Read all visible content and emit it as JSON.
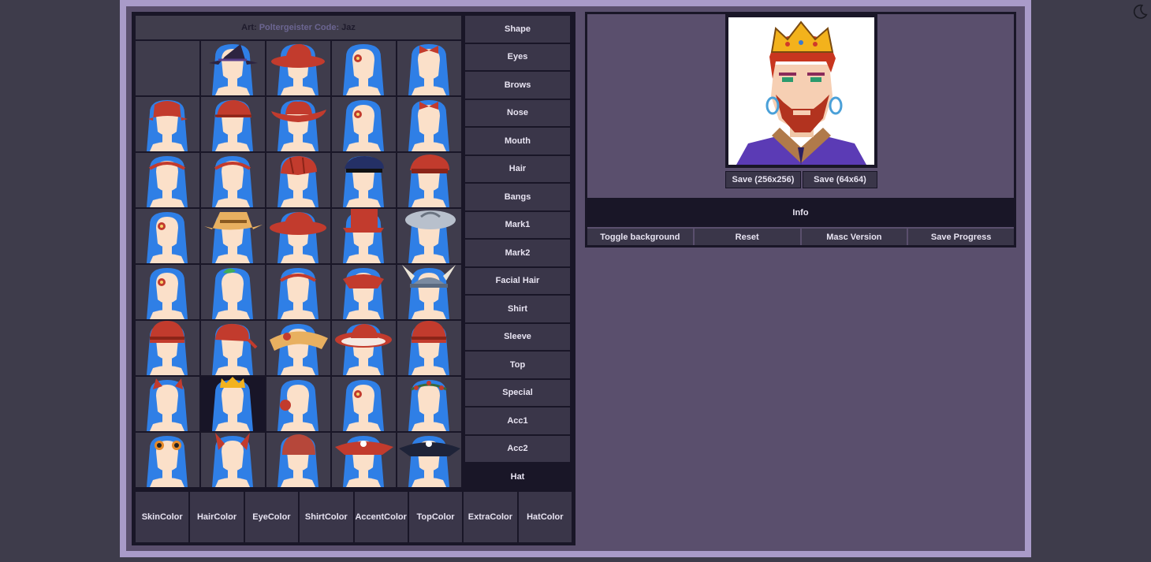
{
  "credit": {
    "art_label": "Art:",
    "art_name": "Poltergeister",
    "code_label": "Code:",
    "code_name": "Jaz"
  },
  "categories": [
    "Shape",
    "Eyes",
    "Brows",
    "Nose",
    "Mouth",
    "Hair",
    "Bangs",
    "Mark1",
    "Mark2",
    "Facial Hair",
    "Shirt",
    "Sleeve",
    "Top",
    "Special",
    "Acc1",
    "Acc2",
    "Hat"
  ],
  "active_category": "Hat",
  "colors": [
    {
      "line1": "Skin",
      "line2": "Color"
    },
    {
      "line1": "Hair",
      "line2": "Color"
    },
    {
      "line1": "Eye",
      "line2": "Color"
    },
    {
      "line1": "Shirt",
      "line2": "Color"
    },
    {
      "line1": "Accent",
      "line2": "Color"
    },
    {
      "line1": "Top",
      "line2": "Color"
    },
    {
      "line1": "Extra",
      "line2": "Color"
    },
    {
      "line1": "Hat",
      "line2": "Color"
    }
  ],
  "save": {
    "large": "Save (256x256)",
    "small": "Save (64x64)"
  },
  "info_label": "Info",
  "actions": [
    "Toggle background",
    "Reset",
    "Masc Version",
    "Save Progress"
  ],
  "hat_options": [
    "none",
    "witch-hat",
    "wide-red-hat",
    "flower-clip",
    "bow",
    "bucket-hat",
    "cap",
    "cowboy-hat",
    "flower-clip",
    "bow",
    "headband",
    "headband",
    "newsboy-cap",
    "navy-cap",
    "red-cap",
    "flower-clip",
    "straw-hat",
    "red-brim-hat",
    "top-hat",
    "silver-cap",
    "flower-clip",
    "leaf-sprout",
    "headband",
    "tricorn",
    "viking-helm",
    "beanie",
    "bandana",
    "sun-hat",
    "white-brim-hat",
    "beanie",
    "cat-ears",
    "crown",
    "ear-muff",
    "flower-clip",
    "flower-crown",
    "goggles",
    "devil-horns",
    "knit-cap",
    "pirate-hat-red",
    "pirate-hat-black"
  ],
  "selected_hat_index": 31,
  "colors_theme": {
    "hair": "#2f7fe6",
    "skin": "#fbe0c9",
    "hat_red": "#c23b2d",
    "crown": "#f2b21f"
  }
}
